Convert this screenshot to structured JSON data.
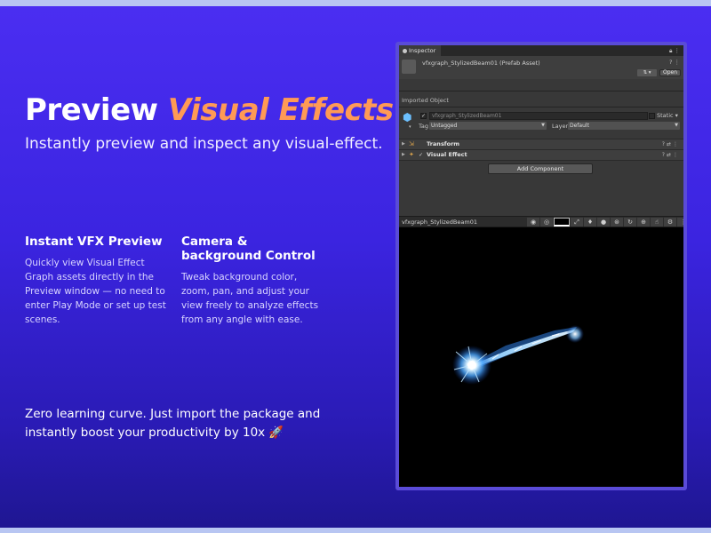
{
  "headline": {
    "part1": "Preview",
    "accent": "Visual Effects"
  },
  "subheadline": "Instantly preview and inspect any visual-effect.",
  "features": [
    {
      "title": "Instant VFX Preview",
      "text": "Quickly view Visual Effect Graph assets directly in the Preview window — no need to enter Play Mode or set up test scenes."
    },
    {
      "title": "Camera & background Control",
      "text": "Tweak background color, zoom, pan, and adjust your view freely to analyze effects from any angle with ease."
    }
  ],
  "footer": "Zero learning curve. Just import the package and instantly boost your productivity by 10x 🚀",
  "colors": {
    "accent": "#ff9a55",
    "background": "#4b2ef2",
    "window_frame": "#5a4bd8"
  },
  "unity": {
    "tab_label": "Inspector",
    "tab_icons": "⋮",
    "asset_title": "vfxgraph_StylizedBeam01 (Prefab Asset)",
    "asset_icons": "⋮",
    "dropdown_label": "⇅ ▾",
    "open_label": "Open",
    "imported_label": "Imported Object",
    "object_name": "vfxgraph_StylizedBeam01",
    "static_label": "Static",
    "tag_label": "Tag",
    "tag_value": "Untagged",
    "layer_label": "Layer",
    "layer_value": "Default",
    "components": [
      {
        "name": "Transform",
        "icon": "⇲",
        "check": ""
      },
      {
        "name": "Visual Effect",
        "icon": "✦",
        "check": "✓"
      }
    ],
    "component_tools": "?⇄⋮",
    "add_component_label": "Add Component",
    "preview_title": "vfxgraph_StylizedBeam01",
    "preview_tools": [
      "eye-icon",
      "camera-icon",
      "color-swatch",
      "expand-icon",
      "light-icon",
      "sphere-icon",
      "gizmo-icon",
      "rotate-icon",
      "grid-icon",
      "cursor-icon",
      "settings-icon"
    ]
  }
}
